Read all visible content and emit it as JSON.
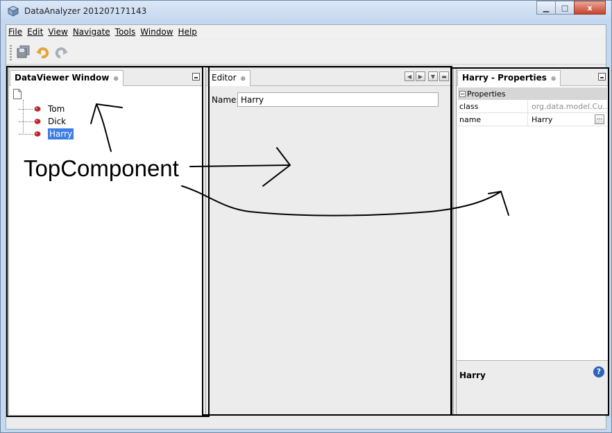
{
  "window": {
    "title": "DataAnalyzer 201207171143",
    "minimize_glyph": "▁",
    "maximize_glyph": "□",
    "close_glyph": "x"
  },
  "menubar": {
    "items": [
      "File",
      "Edit",
      "View",
      "Navigate",
      "Tools",
      "Window",
      "Help"
    ]
  },
  "toolbar": {
    "icons": [
      "save-all-icon",
      "undo-icon",
      "redo-icon"
    ]
  },
  "dataviewer": {
    "tab_label": "DataViewer Window",
    "tab_close": "⊗",
    "root_icon": "document-icon",
    "items": [
      {
        "label": "Tom",
        "icon": "bean-icon",
        "selected": false
      },
      {
        "label": "Dick",
        "icon": "bean-icon",
        "selected": false
      },
      {
        "label": "Harry",
        "icon": "bean-icon",
        "selected": true
      }
    ]
  },
  "editor": {
    "tab_label": "Editor",
    "tab_close": "⊗",
    "name_label": "Name:",
    "name_value": "Harry",
    "nav_left": "◀",
    "nav_right": "▶",
    "dropdown": "▼"
  },
  "properties": {
    "tab_label": "Harry - Properties",
    "tab_close": "⊗",
    "section_label": "Properties",
    "rows": [
      {
        "key": "class",
        "value": "org.data.model.Cu...",
        "readonly": true
      },
      {
        "key": "name",
        "value": "Harry",
        "readonly": false,
        "button": "..."
      }
    ],
    "description_title": "Harry",
    "help_glyph": "?"
  },
  "annotation": {
    "label": "TopComponent"
  },
  "colors": {
    "selection": "#3d7ee5",
    "bean_red": "#c0262b",
    "title_gradient_top": "#dbe8f7",
    "close_button": "#c7412c"
  }
}
